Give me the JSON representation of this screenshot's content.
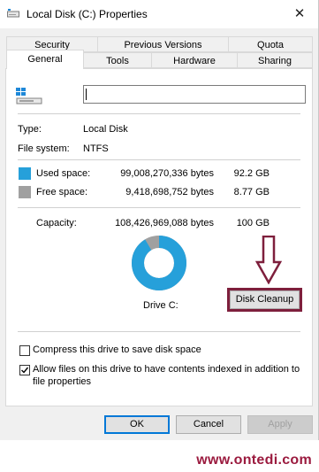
{
  "window": {
    "title": "Local Disk (C:) Properties",
    "close_glyph": "✕"
  },
  "tabs": {
    "row1": [
      "Security",
      "Previous Versions",
      "Quota"
    ],
    "row2": [
      "General",
      "Tools",
      "Hardware",
      "Sharing"
    ],
    "active": "General"
  },
  "general": {
    "drive_name_value": "",
    "type_label": "Type:",
    "type_value": "Local Disk",
    "fs_label": "File system:",
    "fs_value": "NTFS",
    "used_label": "Used space:",
    "used_bytes": "99,008,270,336 bytes",
    "used_gb": "92.2 GB",
    "free_label": "Free space:",
    "free_bytes": "9,418,698,752 bytes",
    "free_gb": "8.77 GB",
    "capacity_label": "Capacity:",
    "capacity_bytes": "108,426,969,088 bytes",
    "capacity_gb": "100 GB",
    "drive_label": "Drive C:",
    "disk_cleanup_label": "Disk Cleanup",
    "used_fraction": 0.913,
    "compress_label": "Compress this drive to save disk space",
    "compress_checked": false,
    "index_label_line1": "Allow files on this drive to have contents indexed in addition to",
    "index_label_line2": "file properties",
    "index_checked": true
  },
  "colors": {
    "used": "#26a0da",
    "free": "#a0a0a0",
    "highlight": "#7e1f3c"
  },
  "icons": [
    "drive-icon",
    "down-arrow-icon",
    "checkmark-icon",
    "close-icon"
  ],
  "buttons": {
    "ok": "OK",
    "cancel": "Cancel",
    "apply": "Apply"
  },
  "watermark": "www.ontedi.com"
}
